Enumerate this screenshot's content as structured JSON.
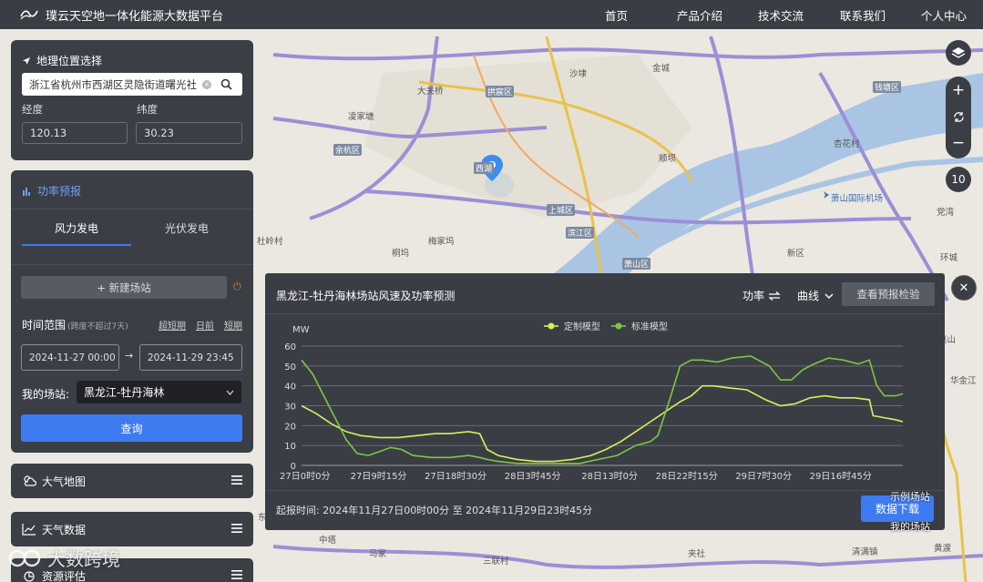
{
  "header": {
    "title": "璞云天空地一体化能源大数据平台",
    "nav": [
      "首页",
      "产品介绍",
      "技术交流",
      "联系我们",
      "个人中心"
    ]
  },
  "location": {
    "title": "地理位置选择",
    "address": "浙江省杭州市西湖区灵隐街道曙光社",
    "lng_label": "经度",
    "lat_label": "纬度",
    "lng": "120.13",
    "lat": "30.23"
  },
  "forecast": {
    "title": "功率预报",
    "tabs": [
      "风力发电",
      "光伏发电"
    ],
    "new_station": "+ 新建场站",
    "time_range_label": "时间范围",
    "time_range_hint": "(跨度不超过7天)",
    "quick": [
      "超短期",
      "日前",
      "短期"
    ],
    "start": "2024-11-27 00:00",
    "end": "2024-11-29 23:45",
    "arrow": "→",
    "station_label": "我的场站:",
    "station": "黑龙江-牡丹海林",
    "query": "查询"
  },
  "sidebar": [
    "大气地图",
    "天气数据",
    "资源评估"
  ],
  "map": {
    "labels": [
      "大关桥",
      "拱宸区",
      "沙埭",
      "金城",
      "凌家塘",
      "余杭区",
      "西湖",
      "顺坝",
      "杏花村",
      "钱塘区",
      "萧山国际机场",
      "上城区",
      "梅家坞",
      "滨江区",
      "党湾",
      "萧山区",
      "新区",
      "杜岭村",
      "桐坞",
      "环城",
      "东局",
      "华金江",
      "马家",
      "三联村",
      "清满镇",
      "黄渡",
      "中塔",
      "夹社",
      "赵山"
    ],
    "zoom": "10",
    "watermark": "大数跨境",
    "legend_tip": [
      "示例场站",
      "我的场站"
    ]
  },
  "modal": {
    "title": "黑龙江-牡丹海林场站风速及功率预测",
    "power_label": "功率",
    "curve_label": "曲线",
    "verify_button": "查看预报检验",
    "time_text": "起报时间: 2024年11月27日00时00分 至 2024年11月29日23时45分",
    "download": "数据下载"
  },
  "chart_data": {
    "type": "line",
    "ylabel": "MW",
    "ylim": [
      0,
      60
    ],
    "yticks": [
      0,
      10,
      20,
      30,
      40,
      50,
      60
    ],
    "xticklabels": [
      "27日0时0分",
      "27日9时15分",
      "27日18时30分",
      "28日3时45分",
      "28日13时0分",
      "28日22时15分",
      "29日7时30分",
      "29日16时45分"
    ],
    "xlim": [
      0,
      288
    ],
    "legend_position": "top-center",
    "grid": true,
    "series": [
      {
        "name": "定制模型",
        "color": "#d8f05a",
        "points": [
          [
            0,
            30
          ],
          [
            8,
            26
          ],
          [
            16,
            21
          ],
          [
            24,
            17
          ],
          [
            32,
            15
          ],
          [
            42,
            14
          ],
          [
            52,
            14
          ],
          [
            62,
            15
          ],
          [
            72,
            16
          ],
          [
            80,
            16
          ],
          [
            90,
            17
          ],
          [
            96,
            16
          ],
          [
            100,
            8
          ],
          [
            106,
            5
          ],
          [
            116,
            3
          ],
          [
            126,
            2
          ],
          [
            136,
            2
          ],
          [
            146,
            3
          ],
          [
            156,
            5
          ],
          [
            164,
            8
          ],
          [
            172,
            12
          ],
          [
            180,
            17
          ],
          [
            188,
            22
          ],
          [
            196,
            27
          ],
          [
            204,
            32
          ],
          [
            210,
            35
          ],
          [
            216,
            40
          ],
          [
            222,
            40
          ],
          [
            230,
            39
          ],
          [
            240,
            38
          ],
          [
            250,
            33
          ],
          [
            258,
            30
          ],
          [
            266,
            31
          ],
          [
            274,
            34
          ],
          [
            282,
            35
          ],
          [
            290,
            34
          ],
          [
            298,
            34
          ],
          [
            306,
            33
          ],
          [
            308,
            25
          ],
          [
            314,
            24
          ],
          [
            320,
            23
          ],
          [
            324,
            22
          ]
        ]
      },
      {
        "name": "标准模型",
        "color": "#7cc842",
        "points": [
          [
            0,
            53
          ],
          [
            6,
            46
          ],
          [
            12,
            35
          ],
          [
            18,
            24
          ],
          [
            24,
            13
          ],
          [
            30,
            6
          ],
          [
            36,
            5
          ],
          [
            42,
            7
          ],
          [
            48,
            9
          ],
          [
            54,
            8
          ],
          [
            60,
            5
          ],
          [
            70,
            4
          ],
          [
            80,
            4
          ],
          [
            90,
            5
          ],
          [
            96,
            4
          ],
          [
            100,
            3
          ],
          [
            106,
            2
          ],
          [
            116,
            1
          ],
          [
            130,
            1
          ],
          [
            140,
            1
          ],
          [
            150,
            1
          ],
          [
            160,
            3
          ],
          [
            170,
            5
          ],
          [
            180,
            10
          ],
          [
            188,
            12
          ],
          [
            192,
            15
          ],
          [
            198,
            32
          ],
          [
            204,
            50
          ],
          [
            210,
            53
          ],
          [
            216,
            53
          ],
          [
            224,
            52
          ],
          [
            232,
            54
          ],
          [
            242,
            55
          ],
          [
            252,
            50
          ],
          [
            258,
            43
          ],
          [
            264,
            43
          ],
          [
            270,
            48
          ],
          [
            276,
            51
          ],
          [
            284,
            54
          ],
          [
            292,
            53
          ],
          [
            300,
            51
          ],
          [
            306,
            53
          ],
          [
            310,
            40
          ],
          [
            314,
            35
          ],
          [
            320,
            35
          ],
          [
            324,
            36
          ]
        ]
      }
    ]
  }
}
